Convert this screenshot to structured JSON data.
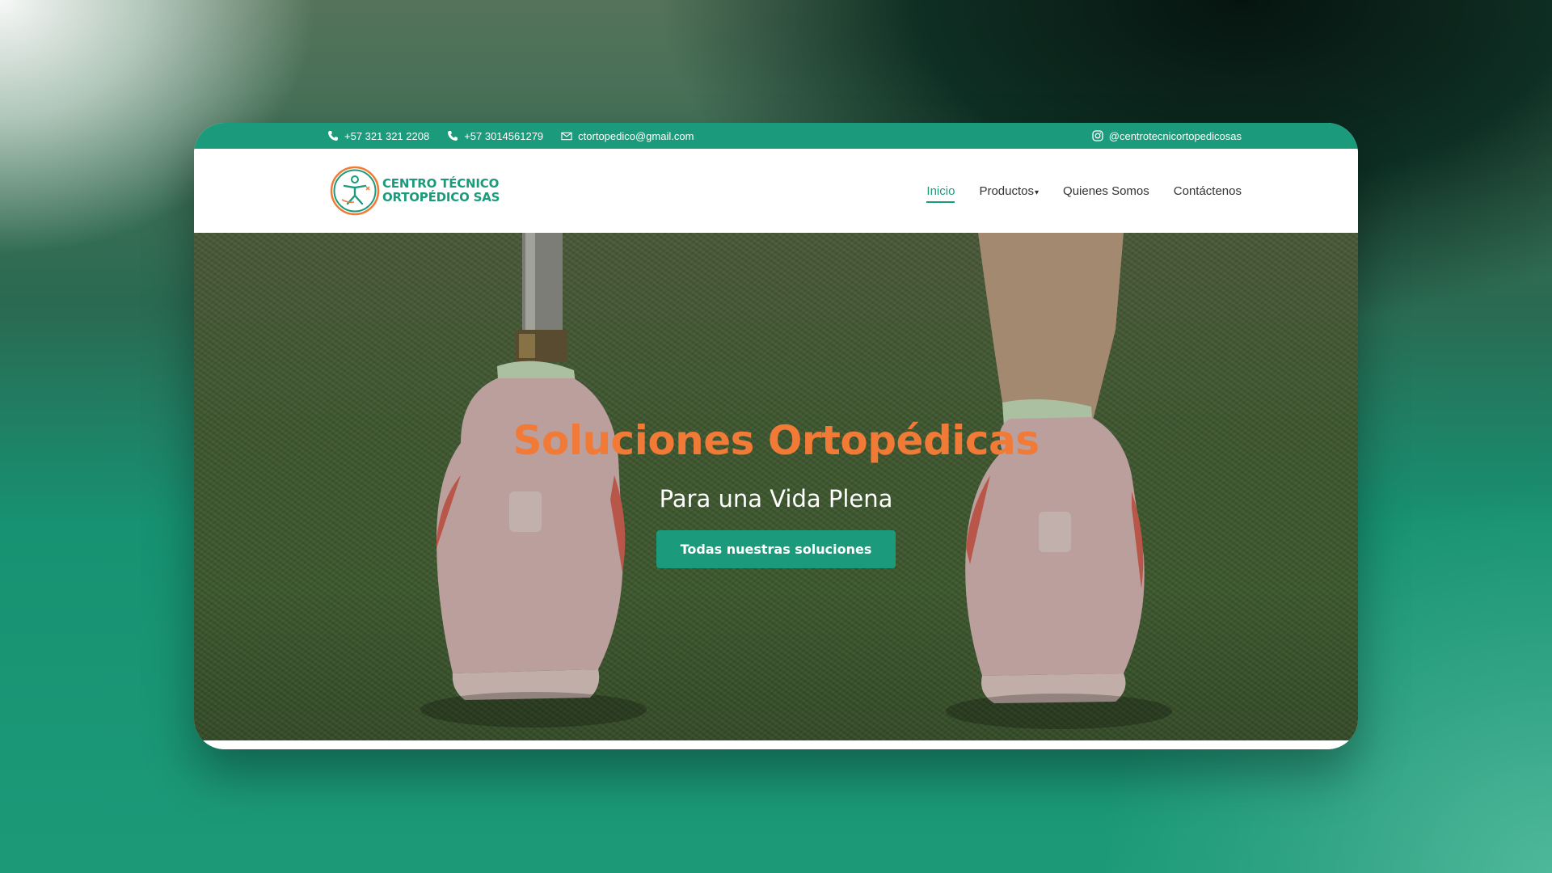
{
  "topbar": {
    "phone1": "+57 321 321 2208",
    "phone2": "+57 3014561279",
    "email": "ctortopedico@gmail.com",
    "instagram": "@centrotecnicortopedicosas",
    "icons": [
      "phone-icon",
      "phone-icon",
      "mail-icon",
      "instagram-icon"
    ]
  },
  "logo": {
    "line1": "CENTRO TÉCNICO",
    "line2": "ORTOPÉDICO SAS"
  },
  "nav": {
    "items": [
      {
        "label": "Inicio",
        "active": true
      },
      {
        "label": "Productos",
        "dropdown": true
      },
      {
        "label": "Quienes Somos"
      },
      {
        "label": "Contáctenos"
      }
    ],
    "caret": "▾"
  },
  "hero": {
    "title": "Soluciones Ortopédicas",
    "subtitle": "Para una Vida Plena",
    "button": "Todas nuestras soluciones"
  },
  "colors": {
    "brand_green": "#1b9b7b",
    "accent_orange": "#f07a36"
  }
}
